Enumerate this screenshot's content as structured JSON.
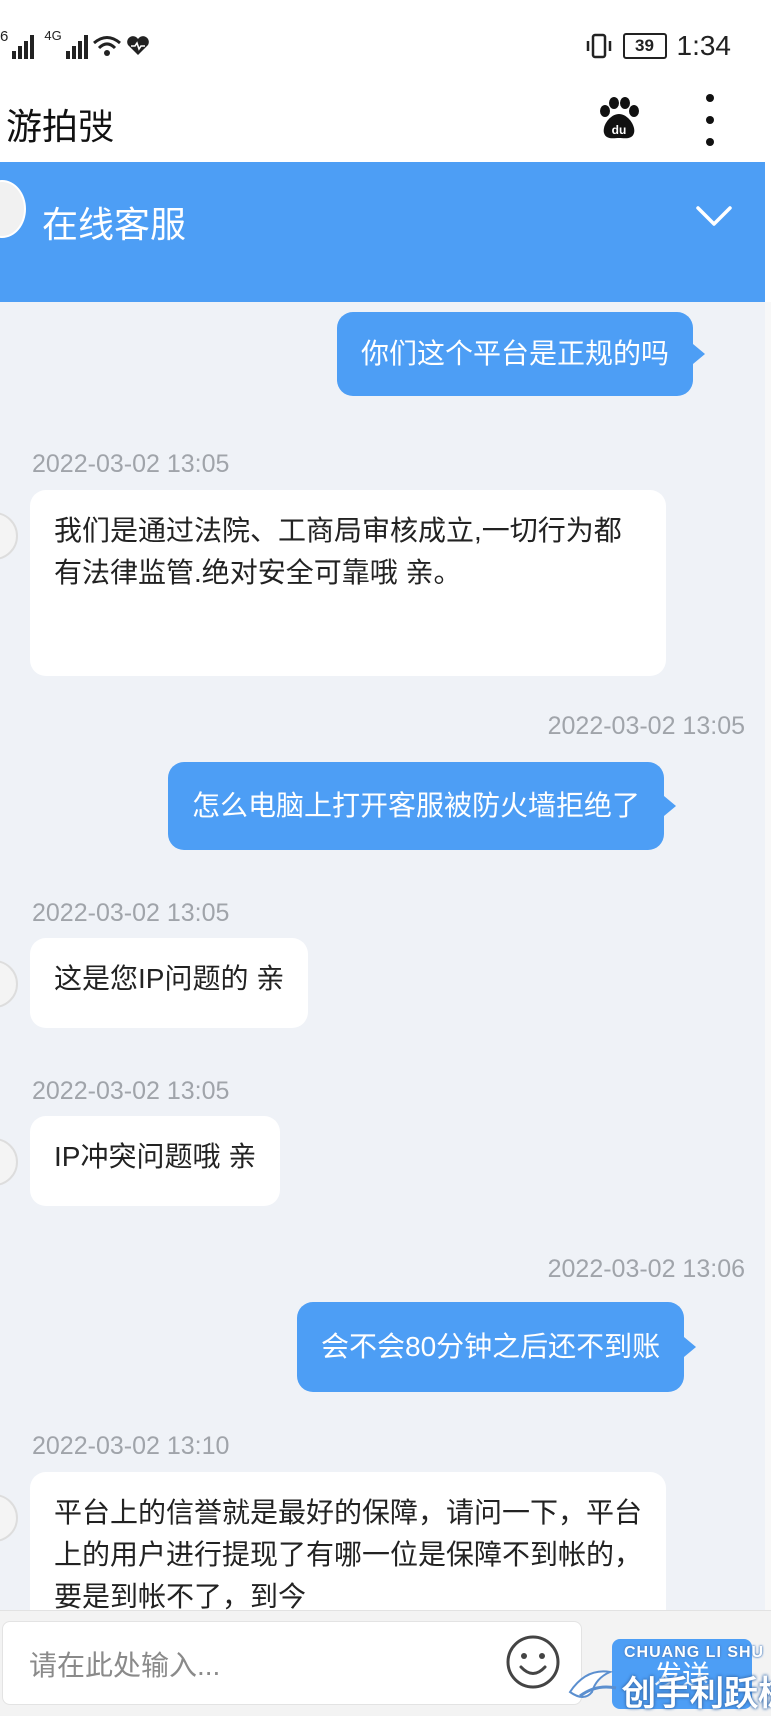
{
  "status_bar": {
    "network_left": "6",
    "network_right": "4G",
    "battery": "39",
    "time": "1:34"
  },
  "app_bar": {
    "title": "游拍弢",
    "icons": [
      "baidu-paw-icon",
      "more-vertical-icon"
    ]
  },
  "chat_header": {
    "title": "在线客服",
    "icon": "chevron-down-icon"
  },
  "messages": [
    {
      "direction": "out",
      "timestamp": "",
      "text": "你们这个平台是正规的吗"
    },
    {
      "direction": "in",
      "timestamp": "2022-03-02 13:05",
      "text": "我们是通过法院、工商局审核成立,一切行为都有法律监管.绝对安全可靠哦 亲。"
    },
    {
      "direction": "out",
      "timestamp": "2022-03-02 13:05",
      "text": "怎么电脑上打开客服被防火墙拒绝了"
    },
    {
      "direction": "in",
      "timestamp": "2022-03-02 13:05",
      "text": "这是您IP问题的 亲"
    },
    {
      "direction": "in",
      "timestamp": "2022-03-02 13:05",
      "text": "IP冲突问题哦 亲"
    },
    {
      "direction": "out",
      "timestamp": "2022-03-02 13:06",
      "text": "会不会80分钟之后还不到账"
    },
    {
      "direction": "in",
      "timestamp": "2022-03-02 13:10",
      "text": "平台上的信誉就是最好的保障，请问一下，平台上的用户进行提现了有哪一位是保障不到帐的，要是到帐不了，到今"
    }
  ],
  "input_bar": {
    "placeholder": "请在此处输入...",
    "emoji_icon": "smiley-icon",
    "send_label": "发送"
  },
  "watermark": {
    "english": "CHUANG LI SHU",
    "chinese": "创手利跃械"
  }
}
